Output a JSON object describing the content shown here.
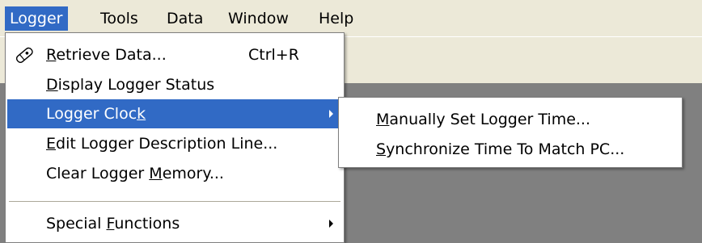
{
  "menubar": {
    "items": [
      {
        "label": "Logger"
      },
      {
        "label": "Tools"
      },
      {
        "label": "Data"
      },
      {
        "label": "Window"
      },
      {
        "label": "Help"
      }
    ]
  },
  "logger_menu": {
    "items": [
      {
        "pre": "",
        "mn": "R",
        "post": "etrieve Data...",
        "shortcut": "Ctrl+R",
        "icon": "retrieve-data-icon"
      },
      {
        "pre": "",
        "mn": "D",
        "post": "isplay Logger Status"
      },
      {
        "pre": "Logger Cloc",
        "mn": "k",
        "post": ""
      },
      {
        "pre": "",
        "mn": "E",
        "post": "dit Logger Description Line..."
      },
      {
        "pre": "Clear Logger ",
        "mn": "M",
        "post": "emory..."
      },
      {
        "pre": "Special ",
        "mn": "F",
        "post": "unctions"
      }
    ]
  },
  "clock_submenu": {
    "items": [
      {
        "pre": "",
        "mn": "M",
        "post": "anually Set Logger Time..."
      },
      {
        "pre": "",
        "mn": "S",
        "post": "ynchronize Time To Match PC..."
      }
    ]
  },
  "colors": {
    "highlight": "#316ac5",
    "menubar_bg": "#ece9d8",
    "workspace_bg": "#808080"
  }
}
